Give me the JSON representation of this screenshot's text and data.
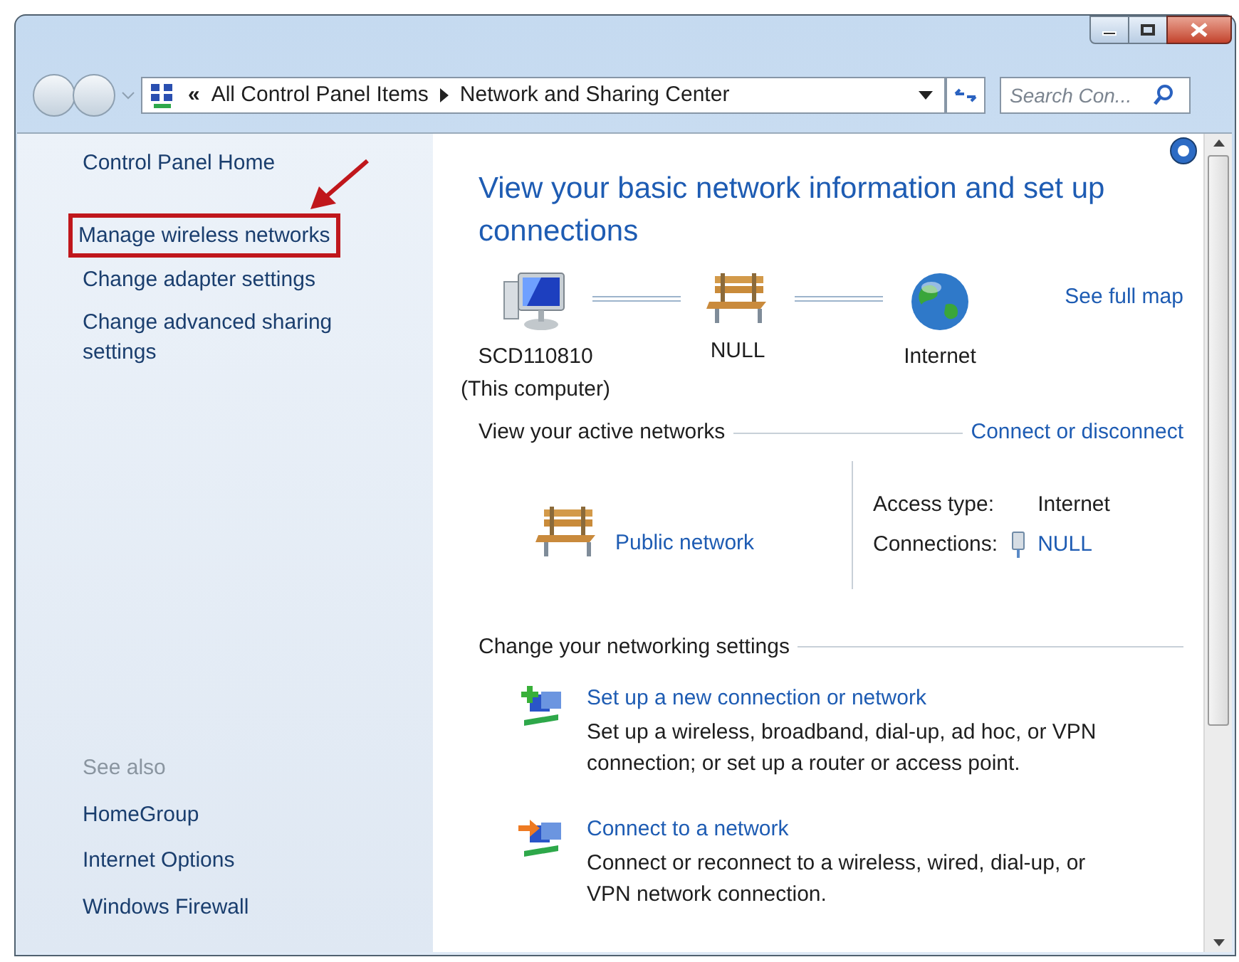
{
  "address_bar": {
    "separator": "«",
    "crumbs": [
      "All Control Panel Items",
      "Network and Sharing Center"
    ]
  },
  "search": {
    "placeholder": "Search Con..."
  },
  "sidebar": {
    "items": [
      {
        "label": "Control Panel Home",
        "highlighted": false
      },
      {
        "label": "Manage wireless networks",
        "highlighted": true
      },
      {
        "label": "Change adapter settings",
        "highlighted": false
      },
      {
        "label": "Change advanced sharing settings",
        "highlighted": false
      }
    ],
    "see_also": {
      "heading": "See also",
      "items": [
        "HomeGroup",
        "Internet Options",
        "Windows Firewall"
      ]
    }
  },
  "main": {
    "title": "View your basic network information and set up connections",
    "map": {
      "see_full_map": "See full map",
      "nodes": [
        {
          "kind": "computer",
          "name": "SCD110810",
          "subtitle": "(This computer)"
        },
        {
          "kind": "bench",
          "name": "NULL"
        },
        {
          "kind": "globe",
          "name": "Internet"
        }
      ]
    },
    "active_networks": {
      "heading": "View your active networks",
      "action": "Connect or disconnect",
      "network_type": "Public network",
      "access_label": "Access type:",
      "access_value": "Internet",
      "connections_label": "Connections:",
      "connections_value": "NULL"
    },
    "settings": {
      "heading": "Change your networking settings",
      "tasks": [
        {
          "kind": "new",
          "title": "Set up a new connection or network",
          "description": "Set up a wireless, broadband, dial-up, ad hoc, or VPN connection; or set up a router or access point."
        },
        {
          "kind": "connect",
          "title": "Connect to a network",
          "description": "Connect or reconnect to a wireless, wired, dial-up, or VPN network connection."
        }
      ]
    }
  }
}
